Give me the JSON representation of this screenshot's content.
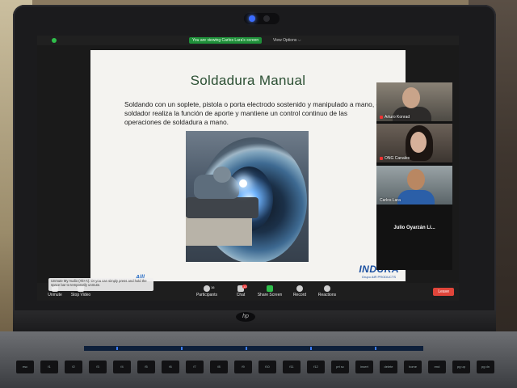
{
  "zoom": {
    "viewing_banner": "You are viewing Carlos Lara's screen",
    "view_options": "View Options ⌵"
  },
  "slide": {
    "title": "Soldadura Manual",
    "body": "Soldando con un soplete, pistola o porta electrodo sostenido y manipulado a mano, el soldador realiza la función de aporte y mantiene un control continuo de las operaciones de soldadura a mano.",
    "logo_left": "Alll",
    "logo_indura": "INDURA",
    "logo_indura_sub": "Grupo AIR PRODUCTS"
  },
  "participants": [
    {
      "name": "Arturo Konrad",
      "muted": true
    },
    {
      "name": "ONG Canales",
      "muted": true
    },
    {
      "name": "Carlos Lara",
      "muted": false
    }
  ],
  "name_only_tile": "Julio Oyarzán Li...",
  "toolbar": {
    "unmute": "Unmute",
    "stop_video": "Stop Video",
    "participants": "Participants",
    "participants_count": "16",
    "chat": "Chat",
    "chat_badge": "13",
    "share_screen": "Share Screen",
    "record": "Record",
    "reactions": "Reactions",
    "leave": "Leave"
  },
  "tooltip": "Unmute My Audio (Alt+A). Or you can simply press and hold the space bar to temporarily unmute.",
  "laptop": {
    "brand": "hp",
    "keys": [
      "esc",
      "f1",
      "f2",
      "f3",
      "f4",
      "f5",
      "f6",
      "f7",
      "f8",
      "f9",
      "f10",
      "f11",
      "f12",
      "prt sc",
      "insert",
      "delete",
      "home",
      "end",
      "pg up",
      "pg dn"
    ]
  }
}
